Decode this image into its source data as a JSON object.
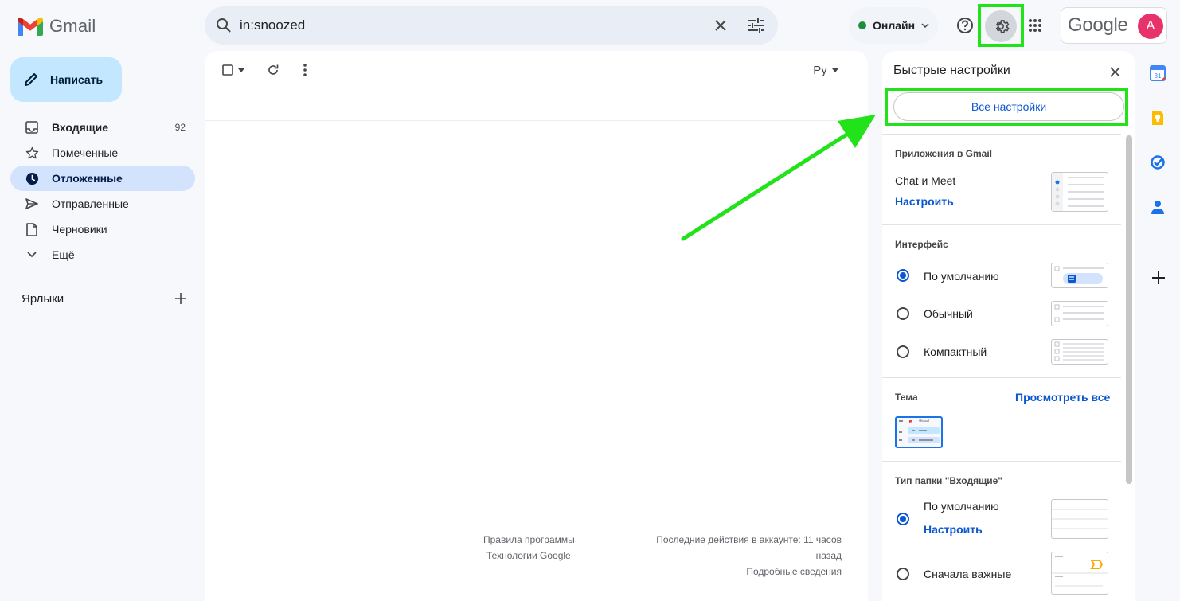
{
  "app": {
    "name": "Gmail"
  },
  "search": {
    "value": "in:snoozed"
  },
  "header": {
    "status_label": "Онлайн",
    "google_logo_text": "Google",
    "avatar_letter": "A"
  },
  "sidebar": {
    "compose_label": "Написать",
    "items": [
      {
        "label": "Входящие",
        "count": "92"
      },
      {
        "label": "Помеченные"
      },
      {
        "label": "Отложенные"
      },
      {
        "label": "Отправленные"
      },
      {
        "label": "Черновики"
      },
      {
        "label": "Ещё"
      }
    ],
    "labels_title": "Ярлыки"
  },
  "toolbar": {
    "input_tool_label": "Ру"
  },
  "footer": {
    "terms": "Правила программы",
    "tech": "Технологии Google",
    "activity_line1": "Последние действия в аккаунте: 11 часов",
    "activity_line2": "назад",
    "details": "Подробные сведения"
  },
  "quick_settings": {
    "title": "Быстрые настройки",
    "all_settings": "Все настройки",
    "apps_section": "Приложения в Gmail",
    "chat_meet": "Chat и Meet",
    "configure": "Настроить",
    "density_section": "Интерфейс",
    "density_options": [
      "По умолчанию",
      "Обычный",
      "Компактный"
    ],
    "theme_section": "Тема",
    "view_all": "Просмотреть все",
    "theme_thumb_text": "Gmail",
    "inbox_type_section": "Тип папки \"Входящие\"",
    "inbox_default": "По умолчанию",
    "inbox_configure": "Настроить",
    "inbox_important": "Сначала важные"
  },
  "colors": {
    "accent": "#0b57d0",
    "highlight": "#22e31a",
    "compose_bg": "#c2e7ff",
    "active_nav": "#d3e3fd",
    "avatar": "#e8336a"
  }
}
